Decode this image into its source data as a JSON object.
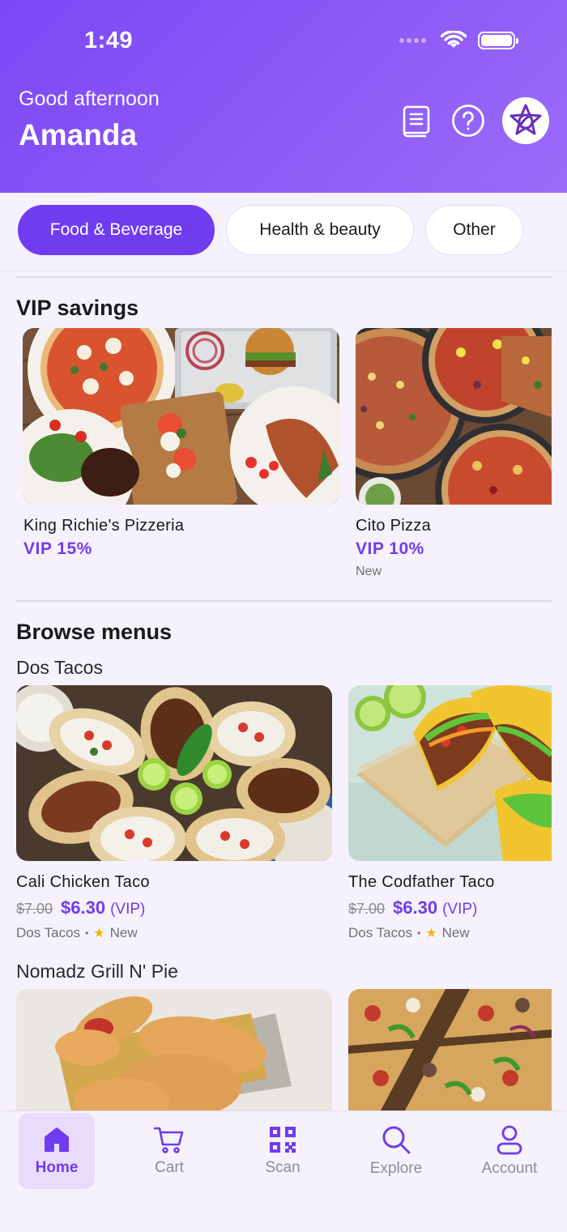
{
  "status": {
    "time": "1:49"
  },
  "header": {
    "greeting": "Good afternoon",
    "name": "Amanda"
  },
  "categories": [
    {
      "label": "Food & Beverage",
      "active": true
    },
    {
      "label": "Health & beauty",
      "active": false
    },
    {
      "label": "Other",
      "active": false
    }
  ],
  "vip": {
    "title": "VIP savings",
    "cards": [
      {
        "name": "King Richie's Pizzeria",
        "discount": "VIP 15%"
      },
      {
        "name": "Cito Pizza",
        "discount": "VIP 10%",
        "badge": "New"
      }
    ]
  },
  "browse": {
    "title": "Browse menus",
    "groups": [
      {
        "restaurant": "Dos Tacos",
        "items": [
          {
            "name": "Cali Chicken Taco",
            "old_price": "$7.00",
            "price": "$6.30",
            "tag": "(VIP)",
            "vendor": "Dos Tacos",
            "badge": "New"
          },
          {
            "name": "The Codfather Taco",
            "old_price": "$7.00",
            "price": "$6.30",
            "tag": "(VIP)",
            "vendor": "Dos Tacos",
            "badge": "New"
          }
        ]
      },
      {
        "restaurant": "Nomadz Grill N' Pie"
      }
    ]
  },
  "nav": [
    {
      "label": "Home",
      "icon": "home-icon",
      "active": true
    },
    {
      "label": "Cart",
      "icon": "cart-icon"
    },
    {
      "label": "Scan",
      "icon": "qr-code-icon"
    },
    {
      "label": "Explore",
      "icon": "search-icon"
    },
    {
      "label": "Account",
      "icon": "user-icon"
    }
  ],
  "colors": {
    "accent": "#6f3cf0",
    "header": "#7b48f5",
    "background": "#f6f2fd"
  }
}
